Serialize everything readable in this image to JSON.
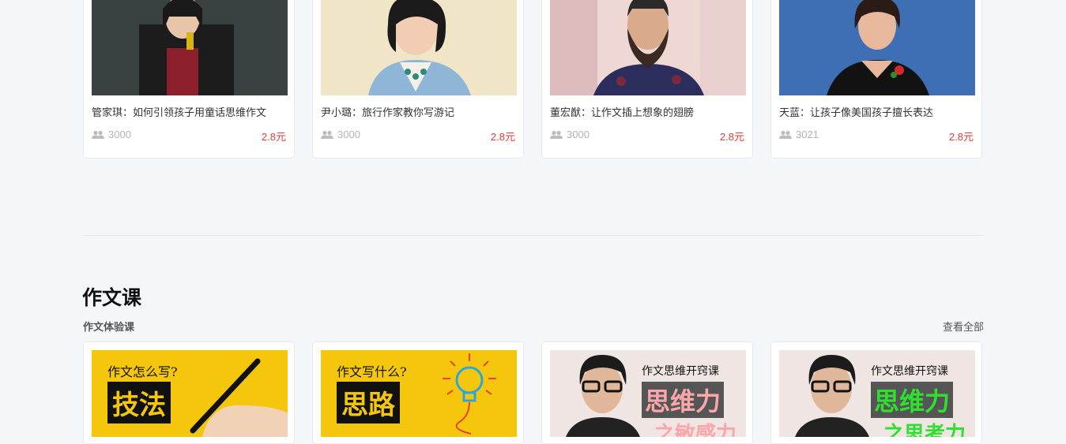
{
  "top_courses": [
    {
      "title": "管家琪：如何引领孩子用童话思维作文",
      "count": "3000",
      "price": "2.8元"
    },
    {
      "title": "尹小璐：旅行作家教你写游记",
      "count": "3000",
      "price": "2.8元"
    },
    {
      "title": "董宏猷：让作文插上想象的翅膀",
      "count": "3000",
      "price": "2.8元"
    },
    {
      "title": "天蓝：让孩子像美国孩子擅长表达",
      "count": "3021",
      "price": "2.8元"
    }
  ],
  "section": {
    "title": "作文课",
    "subtitle": "作文体验课",
    "view_all": "查看全部"
  },
  "bottom_courses": [
    {
      "poster_question": "作文怎么写?",
      "poster_big": "技法"
    },
    {
      "poster_question": "作文写什么?",
      "poster_big": "思路"
    },
    {
      "poster_question": "作文思维开窍课",
      "poster_big": "思维力",
      "poster_sub": "之敏感力"
    },
    {
      "poster_question": "作文思维开窍课",
      "poster_big": "思维力",
      "poster_sub": "之思考力"
    }
  ],
  "colors": {
    "price": "#e03b3b",
    "background": "#f4f7fa",
    "poster_yellow": "#f5c70c",
    "poster_pink": "#f9a7aa",
    "poster_green": "#2fe02f"
  }
}
